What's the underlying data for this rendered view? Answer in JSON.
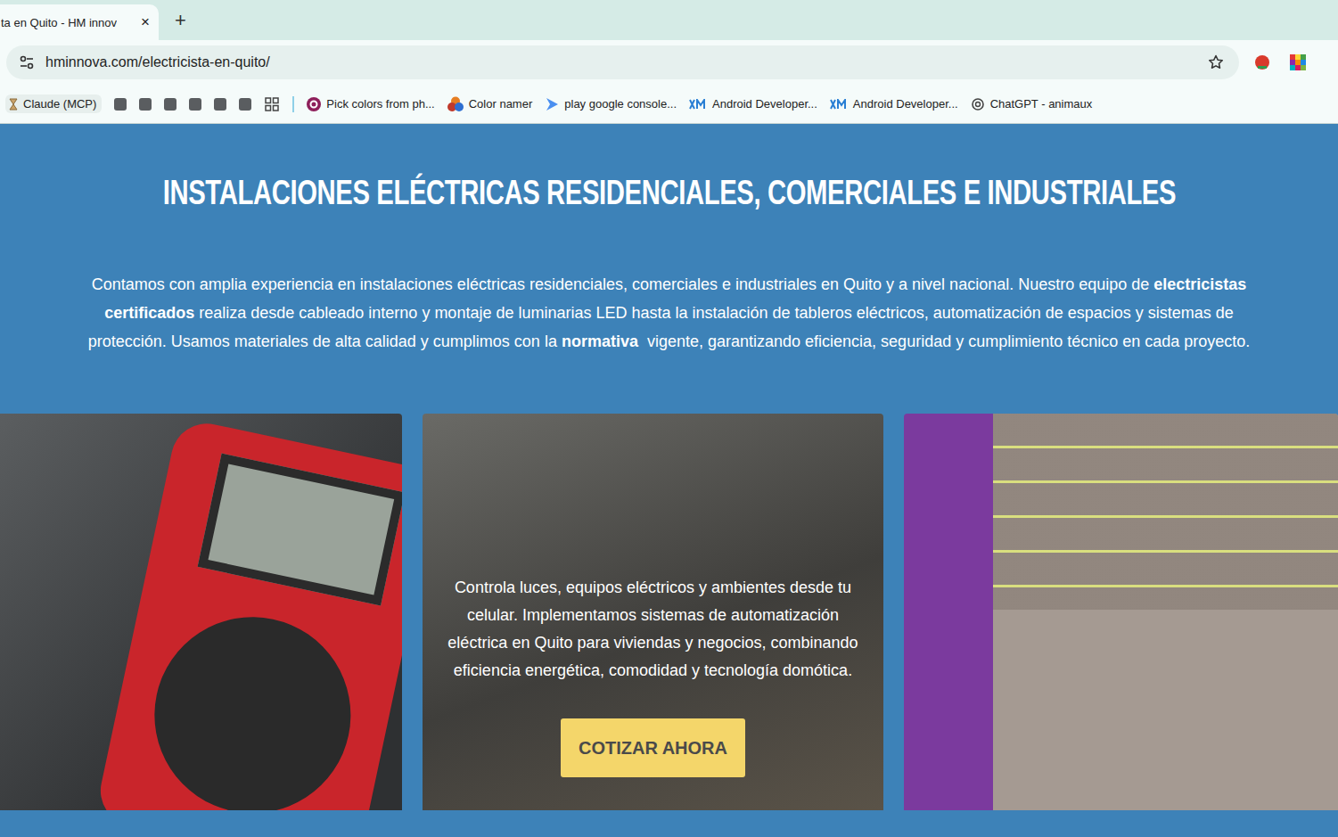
{
  "browser": {
    "tab": {
      "title": "ta en Quito - HM innov",
      "close": "×",
      "selected": true
    },
    "new_tab": "+",
    "url": "hminnova.com/electricista-en-quito/",
    "bookmarks": [
      {
        "kind": "hourglass",
        "label": "Claude (MCP)"
      },
      {
        "kind": "square"
      },
      {
        "kind": "square"
      },
      {
        "kind": "square"
      },
      {
        "kind": "square"
      },
      {
        "kind": "square"
      },
      {
        "kind": "square"
      },
      {
        "kind": "apps"
      },
      {
        "kind": "divider"
      },
      {
        "kind": "picker",
        "label": "Pick colors from ph..."
      },
      {
        "kind": "namer",
        "label": "Color namer"
      },
      {
        "kind": "play",
        "label": "play google console..."
      },
      {
        "kind": "xm",
        "label": "Android Developer..."
      },
      {
        "kind": "xm",
        "label": "Android Developer..."
      },
      {
        "kind": "chatgpt",
        "label": "ChatGPT - animaux"
      }
    ]
  },
  "page": {
    "heading": "INSTALACIONES ELÉCTRICAS RESIDENCIALES, COMERCIALES E INDUSTRIALES",
    "intro": [
      {
        "text": "Contamos con amplia experiencia en instalaciones eléctricas residenciales, comerciales e industriales en Quito y a nivel nacional. Nuestro equipo de ",
        "bold": false
      },
      {
        "text": "electricistas certificados",
        "bold": true
      },
      {
        "text": " realiza desde cableado interno y montaje de luminarias LED hasta la instalación de tableros eléctricos, automatización de espacios y sistemas de protección. Usamos materiales de alta calidad y cumplimos con la ",
        "bold": false
      },
      {
        "text": "normativa",
        "bold": true
      },
      {
        "text": "  vigente, garantizando eficiencia, seguridad y cumplimiento técnico en cada proyecto.",
        "bold": false
      }
    ],
    "cards": [
      {
        "kind": "multimeter"
      },
      {
        "kind": "overlay",
        "text": "Controla luces, equipos eléctricos y ambientes desde tu celular. Implementamos sistemas de automatización eléctrica en Quito para viviendas y negocios, combinando eficiencia energética, comodidad y tecnología domótica.",
        "button": "COTIZAR AHORA"
      },
      {
        "kind": "led"
      }
    ]
  }
}
